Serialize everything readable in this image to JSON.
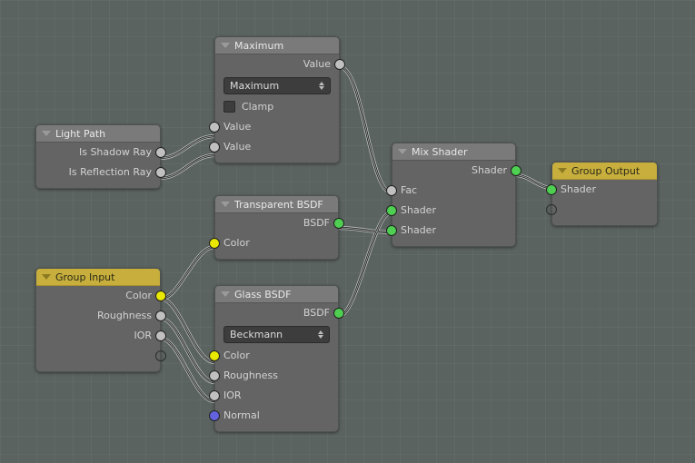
{
  "app": {
    "name": "Blender Node Editor",
    "background_color": "#5b6360",
    "grid_color": "#646c69"
  },
  "palette": {
    "node_body": "#646464",
    "node_header": "#7a7a7a",
    "node_header_accent": "#c7ae3d",
    "socket_shader": "#4fcf51",
    "socket_color": "#e8e800",
    "socket_value": "#c0c0c0",
    "socket_vector": "#6363e0",
    "wire": "#1a1a1a"
  },
  "nodes": {
    "maximum": {
      "title": "Maximum",
      "outputs": [
        {
          "label": "Value",
          "socket": "gray"
        }
      ],
      "select": {
        "value": "Maximum"
      },
      "checkbox": {
        "label": "Clamp",
        "checked": false
      },
      "inputs": [
        {
          "label": "Value",
          "socket": "gray"
        },
        {
          "label": "Value",
          "socket": "gray"
        }
      ]
    },
    "light_path": {
      "title": "Light Path",
      "outputs": [
        {
          "label": "Is Shadow Ray",
          "socket": "gray"
        },
        {
          "label": "Is Reflection Ray",
          "socket": "gray"
        }
      ],
      "inputs": []
    },
    "transparent_bsdf": {
      "title": "Transparent BSDF",
      "outputs": [
        {
          "label": "BSDF",
          "socket": "green"
        }
      ],
      "inputs": [
        {
          "label": "Color",
          "socket": "yellow"
        }
      ]
    },
    "group_input": {
      "title": "Group Input",
      "outputs": [
        {
          "label": "Color",
          "socket": "yellow"
        },
        {
          "label": "Roughness",
          "socket": "gray"
        },
        {
          "label": "IOR",
          "socket": "gray"
        },
        {
          "label": "",
          "socket": "empty"
        }
      ]
    },
    "glass_bsdf": {
      "title": "Glass BSDF",
      "outputs": [
        {
          "label": "BSDF",
          "socket": "green"
        }
      ],
      "select": {
        "value": "Beckmann"
      },
      "inputs": [
        {
          "label": "Color",
          "socket": "yellow"
        },
        {
          "label": "Roughness",
          "socket": "gray"
        },
        {
          "label": "IOR",
          "socket": "gray"
        },
        {
          "label": "Normal",
          "socket": "blue"
        }
      ]
    },
    "mix_shader": {
      "title": "Mix Shader",
      "outputs": [
        {
          "label": "Shader",
          "socket": "green"
        }
      ],
      "inputs": [
        {
          "label": "Fac",
          "socket": "gray"
        },
        {
          "label": "Shader",
          "socket": "green"
        },
        {
          "label": "Shader",
          "socket": "green"
        }
      ]
    },
    "group_output": {
      "title": "Group Output",
      "inputs": [
        {
          "label": "Shader",
          "socket": "green"
        },
        {
          "label": "",
          "socket": "empty"
        }
      ]
    }
  },
  "links": [
    {
      "from": "light_path.is_shadow_ray",
      "to": "maximum.value_1"
    },
    {
      "from": "light_path.is_reflection_ray",
      "to": "maximum.value_2"
    },
    {
      "from": "maximum.value_out",
      "to": "mix_shader.fac"
    },
    {
      "from": "group_input.color",
      "to": "transparent_bsdf.color"
    },
    {
      "from": "group_input.color",
      "to": "glass_bsdf.color"
    },
    {
      "from": "group_input.roughness",
      "to": "glass_bsdf.roughness"
    },
    {
      "from": "group_input.ior",
      "to": "glass_bsdf.ior"
    },
    {
      "from": "transparent_bsdf.bsdf",
      "to": "mix_shader.shader_2"
    },
    {
      "from": "glass_bsdf.bsdf",
      "to": "mix_shader.shader_1"
    },
    {
      "from": "mix_shader.shader_out",
      "to": "group_output.shader"
    }
  ]
}
